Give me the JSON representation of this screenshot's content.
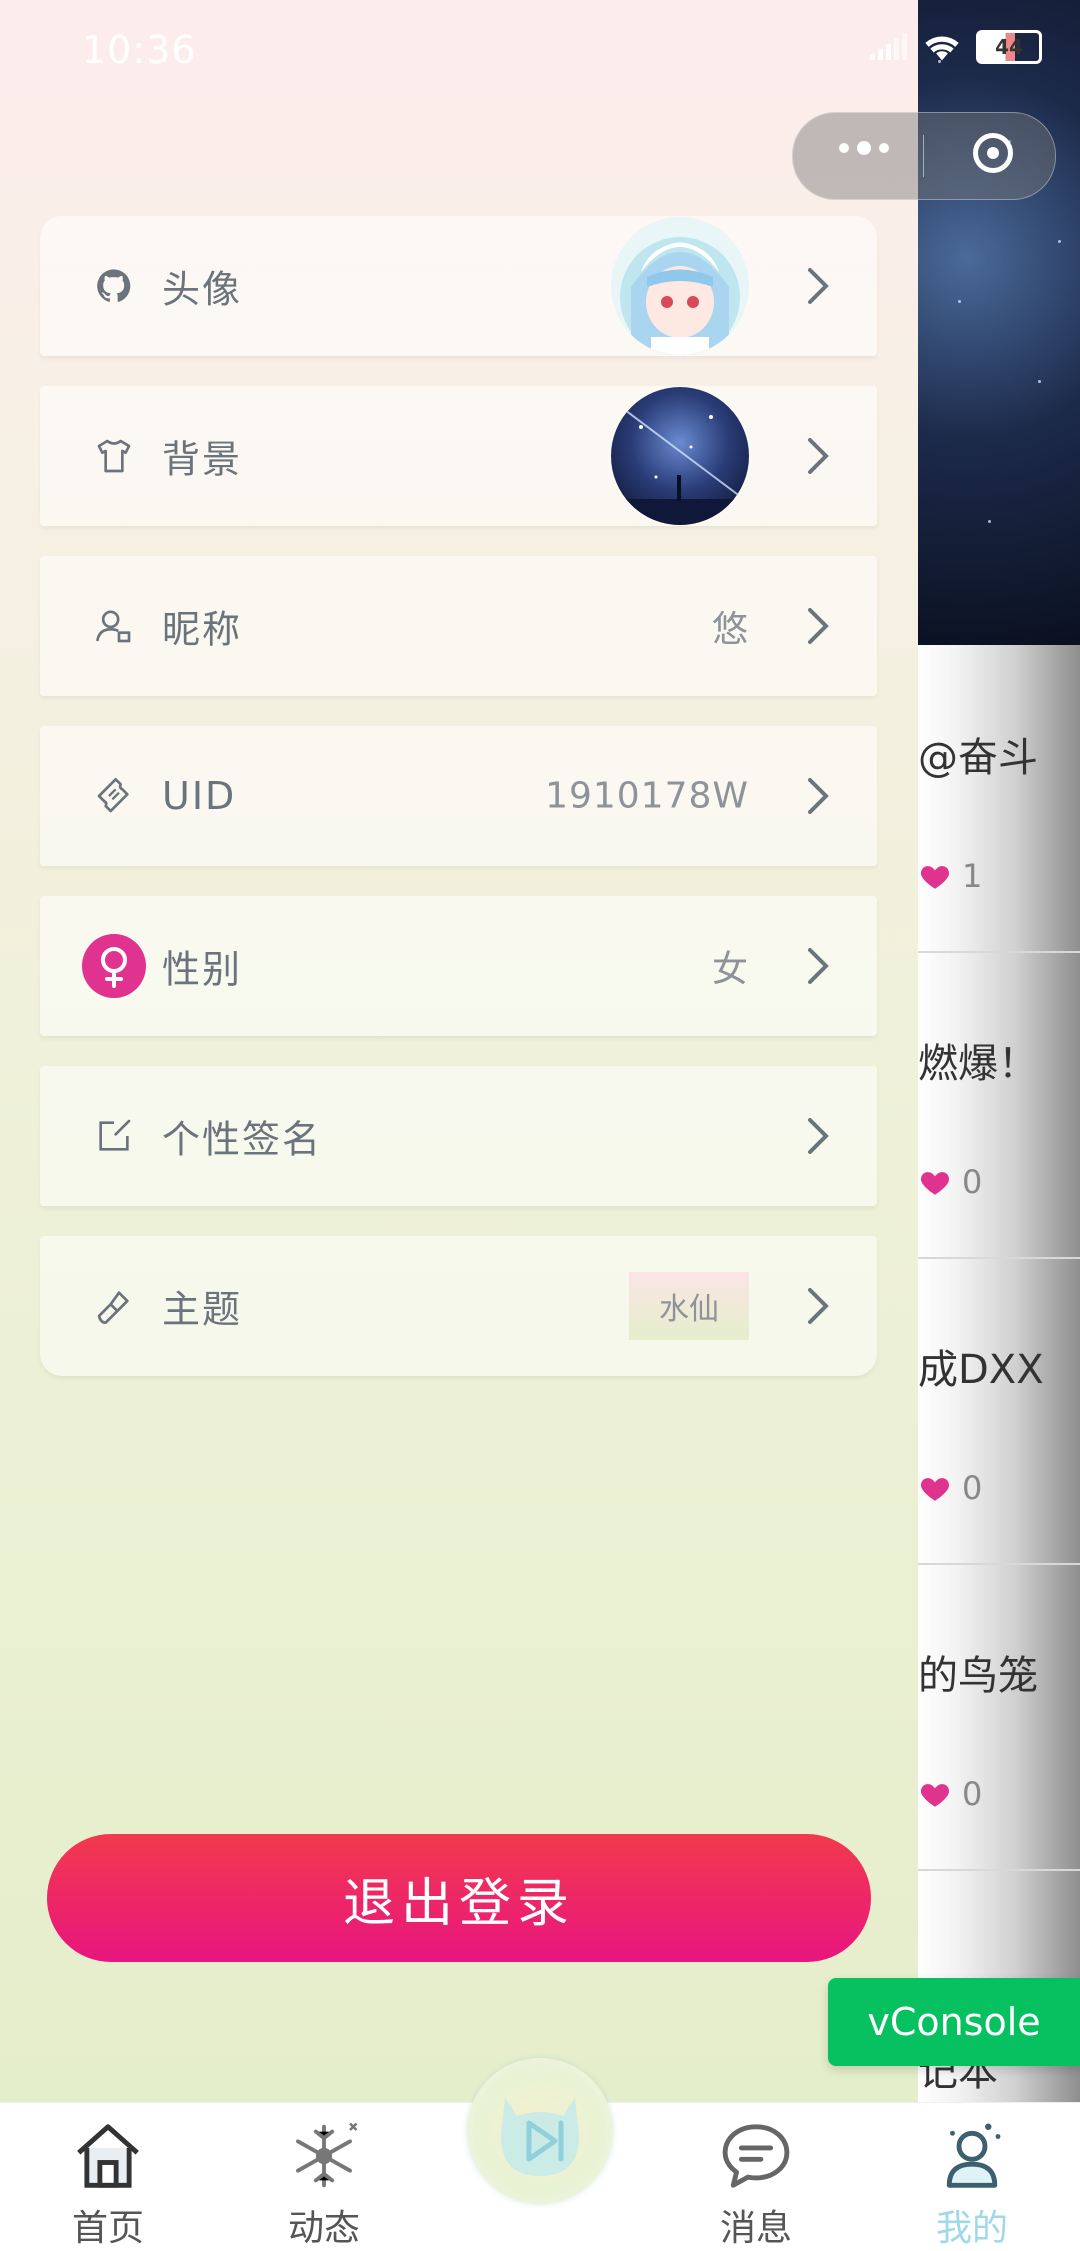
{
  "status_bar": {
    "time": "10:36",
    "battery": "44"
  },
  "drawer": {
    "rows": [
      {
        "label": "头像",
        "icon": "github-cat-icon"
      },
      {
        "label": "背景",
        "icon": "tshirt-icon"
      },
      {
        "label": "昵称",
        "icon": "user-edit-icon",
        "value": "悠"
      },
      {
        "label": "UID",
        "icon": "ticket-icon",
        "value": "1910178W"
      },
      {
        "label": "性别",
        "icon": "female-icon",
        "value": "女"
      },
      {
        "label": "个性签名",
        "icon": "edit-icon"
      },
      {
        "label": "主题",
        "icon": "brush-icon",
        "value": "水仙"
      }
    ],
    "logout_label": "退出登录"
  },
  "background_page": {
    "items": [
      {
        "title": "@奋斗",
        "likes": "1"
      },
      {
        "title": "燃爆！",
        "likes": "0"
      },
      {
        "title": "成DXX",
        "likes": "0"
      },
      {
        "title": "的鸟笼",
        "likes": "0"
      },
      {
        "title": "记本",
        "likes": ""
      }
    ]
  },
  "vconsole_label": "vConsole",
  "tabbar": {
    "tabs": [
      {
        "label": "首页",
        "icon": "home-icon"
      },
      {
        "label": "动态",
        "icon": "snowflake-icon"
      },
      {
        "label": "",
        "icon": "play-cat-icon"
      },
      {
        "label": "消息",
        "icon": "chat-icon"
      },
      {
        "label": "我的",
        "icon": "profile-icon"
      }
    ],
    "active_index": 4
  },
  "colors": {
    "accent_pink": "#e8157f",
    "logout_red": "#f23a4c",
    "gender_pink": "#e0338f",
    "active_tab": "#9fd8e8",
    "vconsole_green": "#07c160"
  }
}
